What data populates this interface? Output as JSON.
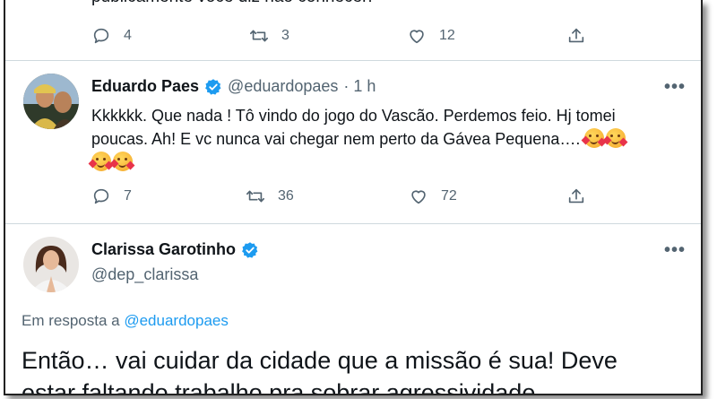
{
  "previous_tweet": {
    "text_partial": "publicamente você diz não conhecer!",
    "replies": "4",
    "retweets": "3",
    "likes": "12"
  },
  "tweet_eduardo": {
    "name": "Eduardo Paes",
    "handle": "@eduardopaes",
    "time": "· 1 h",
    "text_line1": "Kkkkkk.  Que nada !  Tô vindo do jogo do Vascão.  Perdemos feio.  Hj tomei",
    "text_line2": "poucas.  Ah!  E vc nunca vai chegar nem perto da Gávea Pequena….",
    "replies": "7",
    "retweets": "36",
    "likes": "72",
    "more_label": "•••"
  },
  "tweet_clarissa": {
    "name": "Clarissa Garotinho",
    "handle": "@dep_clarissa",
    "reply_prefix": "Em resposta a",
    "reply_link": "@eduardopaes",
    "text_line1": "Então… vai cuidar da cidade que a missão é sua! Deve",
    "text_line2": "estar faltando trabalho pra sobrar agressividade",
    "more_label": "•••"
  },
  "icons": {
    "reply": "reply-icon",
    "retweet": "retweet-icon",
    "like": "heart-icon",
    "share": "share-icon",
    "verified": "verified-badge-icon",
    "emoji": "smiling-face-with-hearts-icon"
  },
  "colors": {
    "verified_blue": "#1d9bf0",
    "link_blue": "#1d9bf0",
    "muted": "#536471",
    "text": "#0f1419",
    "divider": "#cfd9de"
  }
}
